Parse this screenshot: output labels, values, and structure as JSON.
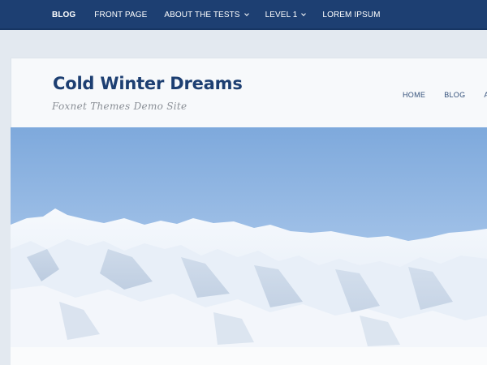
{
  "topnav": {
    "items": [
      {
        "label": "BLOG"
      },
      {
        "label": "FRONT PAGE"
      },
      {
        "label": "ABOUT THE TESTS"
      },
      {
        "label": "LEVEL 1"
      },
      {
        "label": "LOREM IPSUM"
      }
    ]
  },
  "site": {
    "title": "Cold Winter Dreams",
    "tagline": "Foxnet Themes Demo Site"
  },
  "mainnav": {
    "items": [
      {
        "label": "HOME"
      },
      {
        "label": "BLOG"
      },
      {
        "label": "AB"
      }
    ]
  },
  "hero": {
    "icon": "mountain-landscape-image"
  },
  "colors": {
    "topbar": "#1d3f72",
    "title": "#1d3f72",
    "page_bg": "#e3e9f0",
    "sky": "#8cb4e2"
  }
}
